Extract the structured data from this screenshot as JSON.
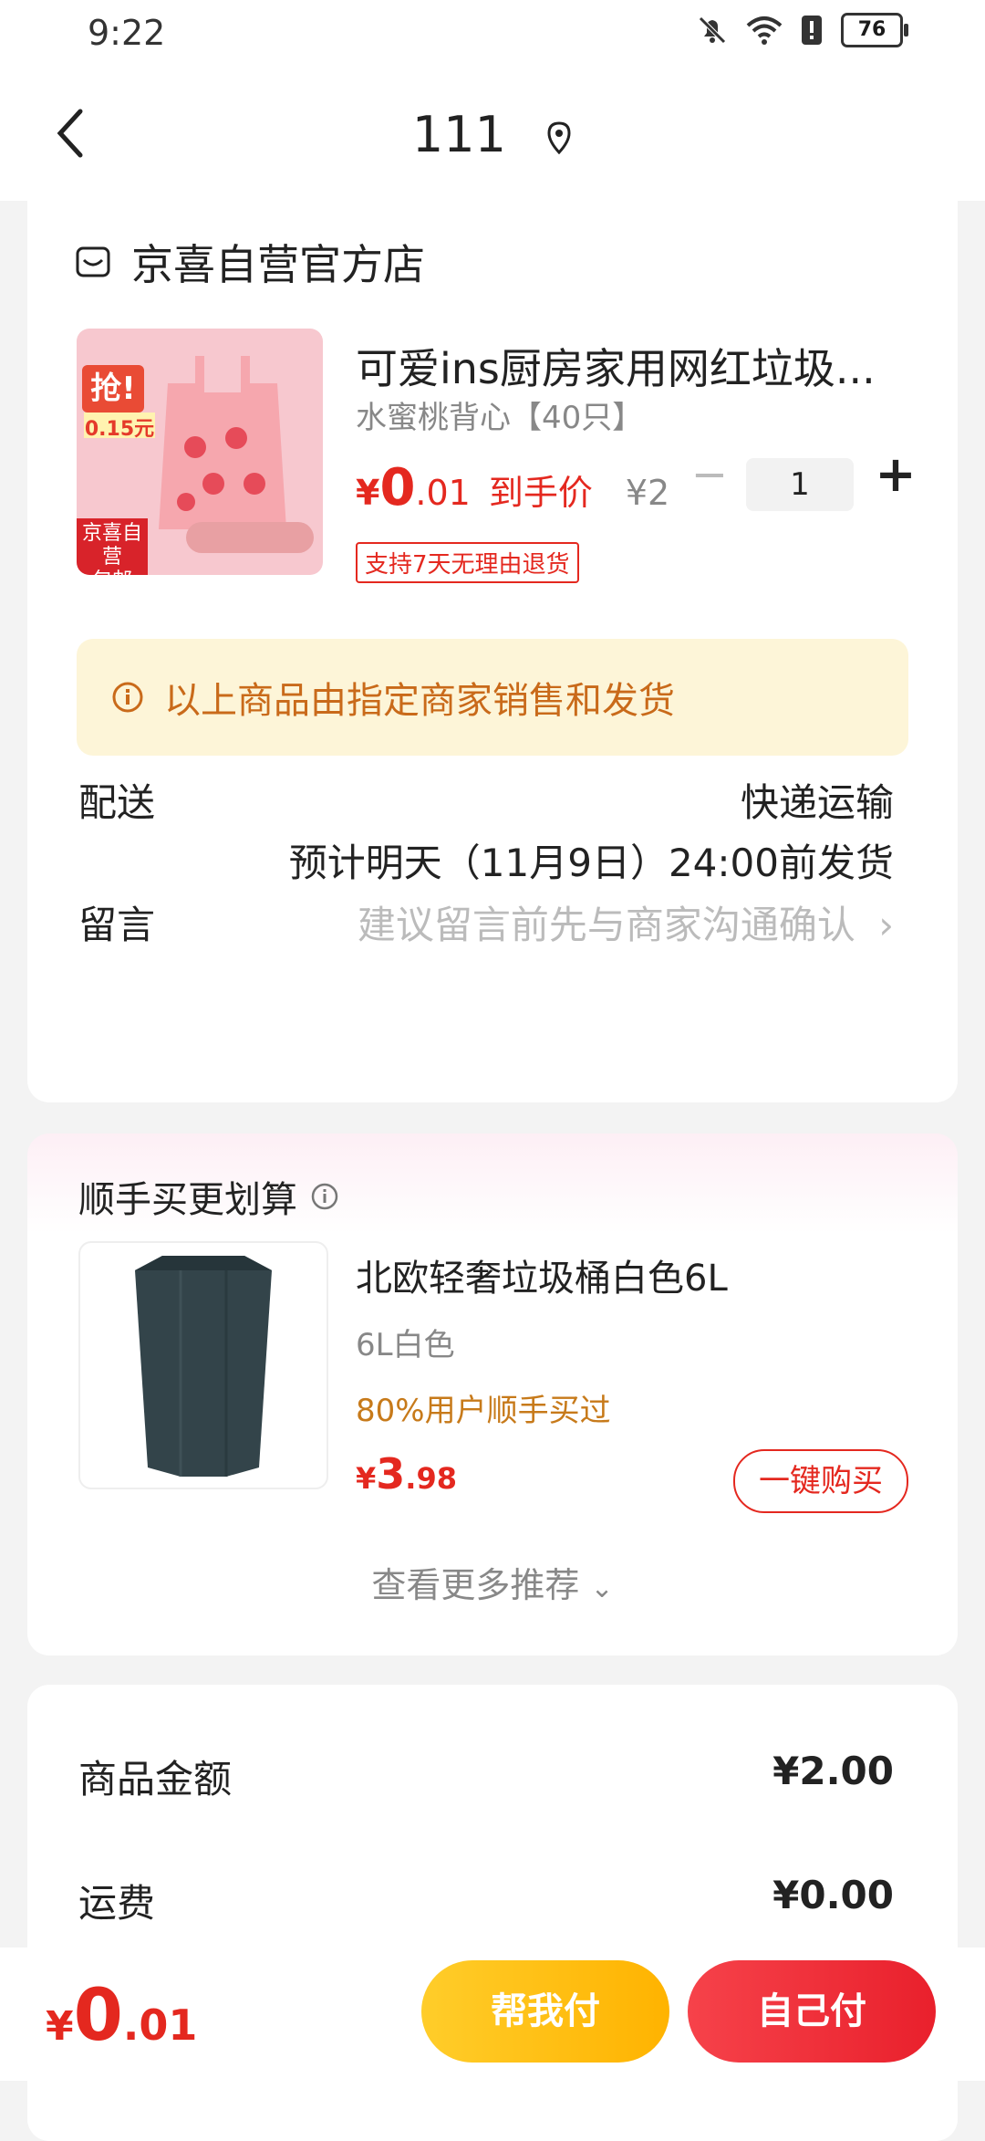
{
  "status_bar": {
    "time": "9:22",
    "battery": "76"
  },
  "nav": {
    "title": "111"
  },
  "store": {
    "name": "京喜自营官方店"
  },
  "product": {
    "title": "可爱ins厨房家用网红垃圾...",
    "spec": "水蜜桃背心【40只】",
    "price_currency": "¥",
    "price_int": "0",
    "price_dec": ".01",
    "price_label": "到手价",
    "original_price": "¥2",
    "minus": "−",
    "quantity": "1",
    "plus": "+",
    "return_policy": "支持7天无理由退货",
    "image_badges": {
      "qiang": "抢!",
      "price": "0.15元",
      "bottom_line1": "京喜自营",
      "bottom_line2": "包邮"
    }
  },
  "notice": {
    "text": "以上商品由指定商家销售和发货"
  },
  "delivery": {
    "label": "配送",
    "method": "快递运输",
    "estimate": "预计明天（11月9日）24:00前发货"
  },
  "remark": {
    "label": "留言",
    "placeholder": "建议留言前先与商家沟通确认"
  },
  "recommend": {
    "section_title": "顺手买更划算",
    "item": {
      "title": "北欧轻奢垃圾桶白色6L",
      "spec": "6L白色",
      "hint": "80%用户顺手买过",
      "price_currency": "¥",
      "price_int": "3",
      "price_dec": ".98",
      "buy_label": "一键购买"
    },
    "more_label": "查看更多推荐"
  },
  "summary": {
    "goods_label": "商品金额",
    "goods_value": "¥2.00",
    "shipping_label": "运费",
    "shipping_value": "¥0.00"
  },
  "bottom": {
    "currency": "¥",
    "total_int": "0",
    "total_dec": ".01",
    "help_pay": "帮我付",
    "self_pay": "自己付"
  },
  "colors": {
    "accent_red": "#e4281f",
    "notice_bg": "#fdf5d8",
    "help_btn": "#ffc107",
    "self_btn": "#ef2d36"
  }
}
